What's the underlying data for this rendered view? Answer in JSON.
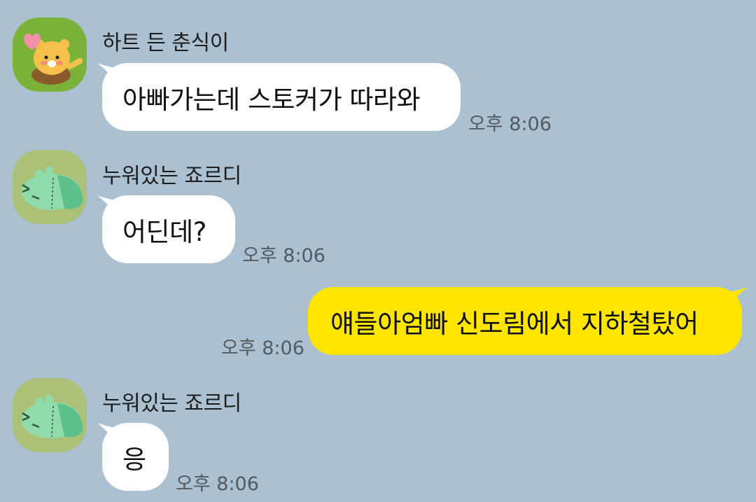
{
  "messages": [
    {
      "sender": "하트 든 춘식이",
      "avatar_icon": "choonsik-heart-avatar-icon",
      "text": "아빠가는데 스토커가 따라와",
      "time": "오후 8:06"
    },
    {
      "sender": "누워있는 죠르디",
      "avatar_icon": "jordy-lying-avatar-icon",
      "text": "어딘데?",
      "time": "오후 8:06"
    },
    {
      "sender": "",
      "text": "얘들아엄빠 신도림에서 지하철탔어",
      "time": "오후 8:06"
    },
    {
      "sender": "누워있는 죠르디",
      "avatar_icon": "jordy-lying-avatar-icon",
      "text": "응",
      "time": "오후 8:06"
    }
  ],
  "colors": {
    "background": "#abc1d1",
    "incoming_bubble": "#ffffff",
    "outgoing_bubble": "#fee500",
    "time_text": "#525a61"
  }
}
